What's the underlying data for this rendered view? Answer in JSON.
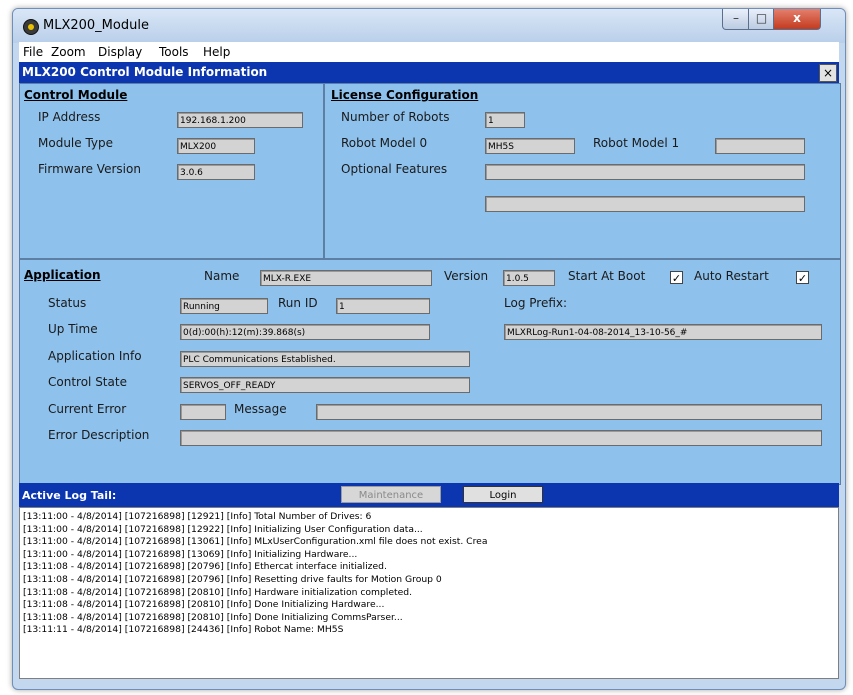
{
  "window": {
    "title": "MLX200_Module",
    "icon": "robot-app-icon"
  },
  "menu": [
    "File",
    "Zoom",
    "Display",
    "Tools",
    "Help"
  ],
  "panel": {
    "title": "MLX200 Control Module Information",
    "close": "×"
  },
  "control_module": {
    "heading": "Control Module",
    "ip_label": "IP Address",
    "ip": "192.168.1.200",
    "type_label": "Module Type",
    "type": "MLX200",
    "fw_label": "Firmware Version",
    "fw": "3.0.6"
  },
  "license": {
    "heading": "License Configuration",
    "robots_label": "Number of Robots",
    "robots": "1",
    "model0_label": "Robot Model 0",
    "model0": "MH5S",
    "model1_label": "Robot Model 1",
    "model1": "",
    "features_label": "Optional Features",
    "feature1": "",
    "feature2": ""
  },
  "application": {
    "heading": "Application",
    "name_label": "Name",
    "name": "MLX-R.EXE",
    "version_label": "Version",
    "version": "1.0.5",
    "start_at_boot_label": "Start At Boot",
    "start_at_boot": true,
    "auto_restart_label": "Auto Restart",
    "auto_restart": true,
    "status_label": "Status",
    "status": "Running",
    "run_id_label": "Run ID",
    "run_id": "1",
    "log_prefix_label": "Log Prefix:",
    "log_prefix": "MLXRLog-Run1-04-08-2014_13-10-56_#",
    "uptime_label": "Up Time",
    "uptime": "0(d):00(h):12(m):39.868(s)",
    "info_label": "Application Info",
    "info": "PLC Communications Established.",
    "state_label": "Control State",
    "state": "SERVOS_OFF_READY",
    "error_label": "Current Error",
    "error": "",
    "message_label": "Message",
    "message": "",
    "error_desc_label": "Error Description",
    "error_desc": ""
  },
  "log": {
    "title": "Active Log Tail:",
    "maintenance": "Maintenance",
    "login": "Login",
    "lines": [
      "[13:11:00 - 4/8/2014] [107216898] [12921] [Info] Total Number of Drives: 6",
      "[13:11:00 - 4/8/2014] [107216898] [12922] [Info] Initializing User Configuration data...",
      "[13:11:00 - 4/8/2014] [107216898] [13061] [Info] MLxUserConfiguration.xml file does not exist. Crea",
      "[13:11:00 - 4/8/2014] [107216898] [13069] [Info] Initializing Hardware...",
      "[13:11:08 - 4/8/2014] [107216898] [20796] [Info] Ethercat interface initialized.",
      "[13:11:08 - 4/8/2014] [107216898] [20796] [Info] Resetting drive faults for Motion Group 0",
      "[13:11:08 - 4/8/2014] [107216898] [20810] [Info] Hardware initialization completed.",
      "[13:11:08 - 4/8/2014] [107216898] [20810] [Info] Done Initializing Hardware...",
      "[13:11:08 - 4/8/2014] [107216898] [20810] [Info] Done Initializing CommsParser...",
      "[13:11:11 - 4/8/2014] [107216898] [24436] [Info] Robot Name: MH5S"
    ]
  }
}
